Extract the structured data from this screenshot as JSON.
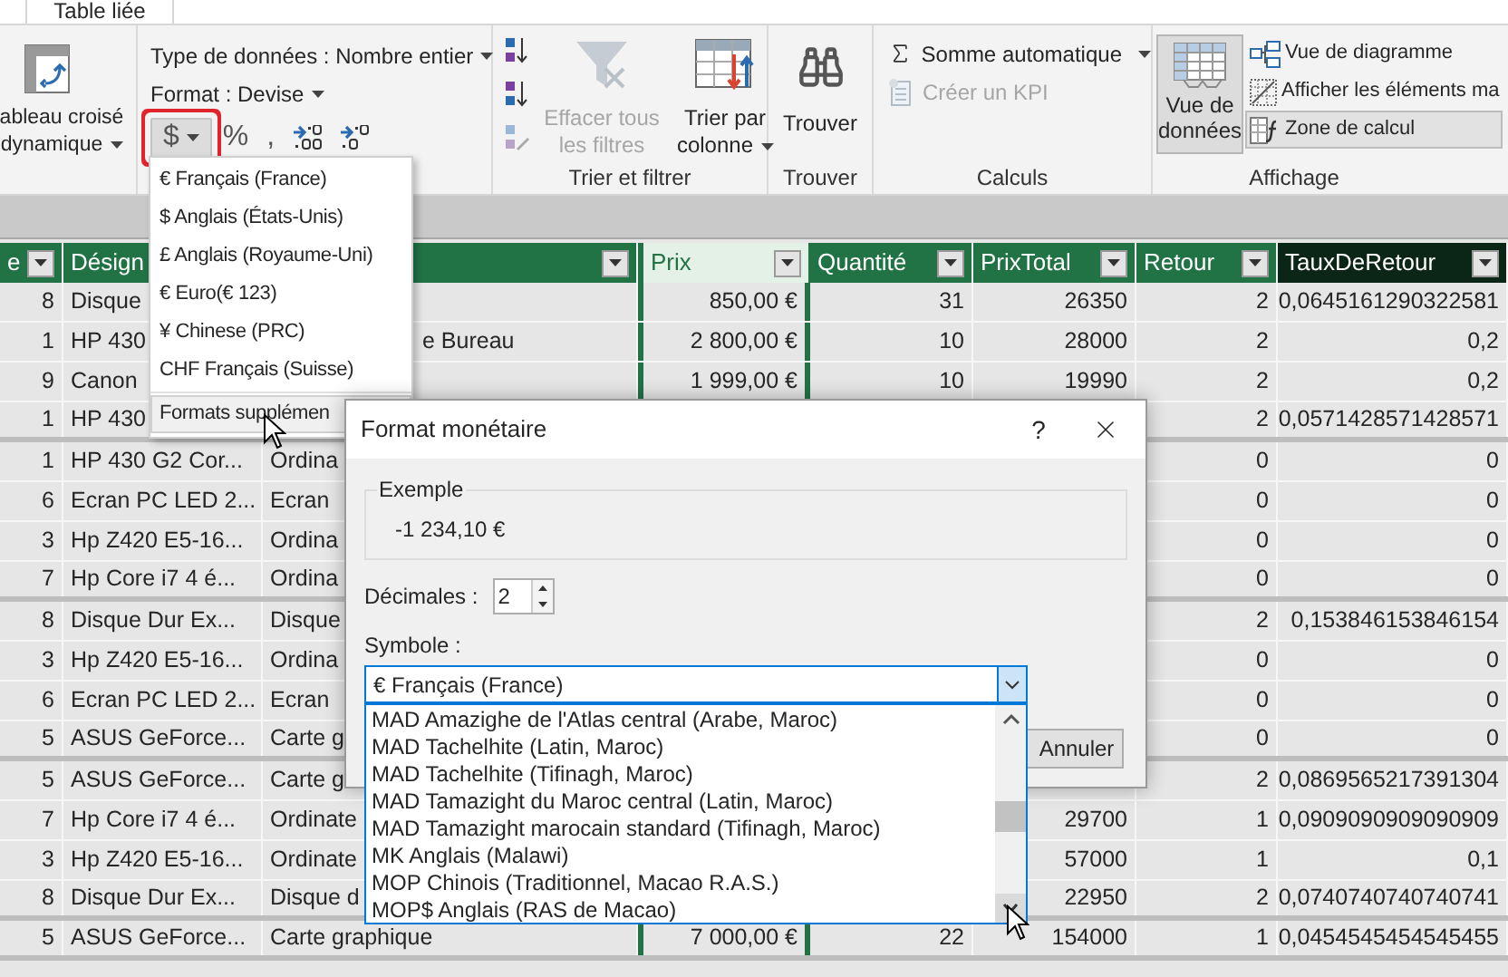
{
  "app_tab": {
    "label": "Table liée"
  },
  "ribbon": {
    "pivot": {
      "label": "ableau croisé dynamique"
    },
    "format_group": {
      "data_type": "Type de données : Nombre entier",
      "format": "Format : Devise",
      "buttons": [
        {
          "kind": "dropdown",
          "label": "$",
          "highlighted": true
        },
        {
          "kind": "text",
          "label": "%",
          "highlighted": false
        },
        {
          "kind": "text",
          "label": ",",
          "highlighted": false
        },
        {
          "kind": "increase-decimals",
          "highlighted": false
        },
        {
          "kind": "decrease-decimals",
          "highlighted": false
        }
      ]
    },
    "sort_group": {
      "title": "Trier et filtrer",
      "buttons": [
        {
          "kind": "clear-filters",
          "label": "Effacer tous les filtres",
          "disabled": true
        },
        {
          "kind": "sort-by-column",
          "label": "Trier par colonne",
          "disabled": false
        }
      ]
    },
    "find_group": {
      "button": "Trouver",
      "title": "Trouver"
    },
    "calc_group": {
      "title": "Calculs",
      "items": [
        {
          "kind": "autosum",
          "label": "Somme automatique",
          "disabled": false
        },
        {
          "kind": "kpi",
          "label": "Créer un KPI",
          "disabled": true
        }
      ]
    },
    "view_group": {
      "title": "Affichage",
      "data_view": {
        "label": "Vue de données",
        "selected": true
      },
      "items": [
        {
          "kind": "diagram",
          "label": "Vue de diagramme",
          "selected": false
        },
        {
          "kind": "hidden",
          "label": "Afficher les éléments ma",
          "selected": false
        },
        {
          "kind": "calc",
          "label": "Zone de calcul",
          "selected": true
        }
      ]
    }
  },
  "table": {
    "columns": [
      {
        "label": "e",
        "selected": false,
        "highlighted": false
      },
      {
        "label": "Désign",
        "selected": false,
        "highlighted": false
      },
      {
        "selected": false,
        "highlighted": false
      },
      {
        "label": "Prix",
        "selected": true,
        "highlighted": false
      },
      {
        "label": "Quantité",
        "selected": false,
        "highlighted": false
      },
      {
        "label": "PrixTotal",
        "selected": false,
        "highlighted": false
      },
      {
        "label": "Retour",
        "selected": false,
        "highlighted": false
      },
      {
        "label": "TauxDeRetour",
        "selected": false,
        "highlighted": true
      }
    ],
    "rows": [
      {
        "cells": [
          "8",
          "Disque",
          null,
          "850,00 €",
          "31",
          "26350",
          "2",
          "0,0645161290322581"
        ]
      },
      {
        "cells": [
          "1",
          "HP 430",
          {
            "kind": "cut",
            "text": "e Bureau"
          },
          "2 800,00 €",
          "10",
          "28000",
          "2",
          "0,2"
        ]
      },
      {
        "cells": [
          "9",
          "Canon",
          null,
          "1 999,00 €",
          "10",
          "19990",
          "2",
          "0,2"
        ]
      },
      {
        "cells": [
          "1",
          "HP 430",
          null,
          null,
          null,
          null,
          "2",
          "0,0571428571428571"
        ]
      },
      {
        "cells": [
          "1",
          "HP 430 G2 Cor...",
          "Ordina",
          null,
          null,
          null,
          "0",
          "0"
        ]
      },
      {
        "cells": [
          "6",
          "Ecran PC LED 2...",
          "Ecran",
          null,
          null,
          null,
          "0",
          "0"
        ]
      },
      {
        "cells": [
          "3",
          "Hp Z420 E5-16...",
          "Ordina",
          null,
          null,
          null,
          "0",
          "0"
        ]
      },
      {
        "cells": [
          "7",
          "Hp Core i7 4 é...",
          "Ordina",
          null,
          null,
          null,
          "0",
          "0"
        ]
      },
      {
        "cells": [
          "8",
          "Disque Dur Ex...",
          "Disque",
          null,
          null,
          null,
          "2",
          "0,153846153846154"
        ]
      },
      {
        "cells": [
          "3",
          "Hp Z420 E5-16...",
          "Ordina",
          null,
          null,
          null,
          "0",
          "0"
        ]
      },
      {
        "cells": [
          "6",
          "Ecran PC LED 2...",
          "Ecran",
          null,
          null,
          null,
          "0",
          "0"
        ]
      },
      {
        "cells": [
          "5",
          "ASUS GeForce...",
          "Carte g",
          null,
          null,
          null,
          "0",
          "0"
        ]
      },
      {
        "cells": [
          "5",
          "ASUS GeForce...",
          "Carte g",
          null,
          null,
          null,
          "2",
          "0,0869565217391304"
        ]
      },
      {
        "cells": [
          "7",
          "Hp Core i7 4 é...",
          "Ordinate",
          null,
          null,
          "29700",
          "1",
          "0,0909090909090909"
        ]
      },
      {
        "cells": [
          "3",
          "Hp Z420 E5-16...",
          "Ordinate",
          null,
          null,
          "57000",
          "1",
          "0,1"
        ]
      },
      {
        "cells": [
          "8",
          "Disque Dur Ex...",
          "Disque d",
          null,
          null,
          "22950",
          "2",
          "0,0740740740740741"
        ]
      },
      {
        "cells": [
          "5",
          "ASUS GeForce...",
          "Carte graphique",
          "7 000,00 €",
          "22",
          "154000",
          "1",
          "0,0454545454545455"
        ]
      }
    ]
  },
  "currency_menu": {
    "items": [
      {
        "label": "€ Français (France)",
        "selected": false
      },
      {
        "label": "$ Anglais (États-Unis)",
        "selected": false
      },
      {
        "label": "£ Anglais (Royaume-Uni)",
        "selected": false
      },
      {
        "label": "€ Euro(€ 123)",
        "selected": false
      },
      {
        "label": "¥ Chinese (PRC)",
        "selected": false
      },
      {
        "label": "CHF Français (Suisse)",
        "selected": false
      },
      {
        "label": "Formats supplémen",
        "selected": true
      }
    ]
  },
  "dialog": {
    "title": "Format monétaire",
    "help": "?",
    "example_label": "Exemple",
    "example_value": "-1 234,10 €",
    "decimals_label": "Décimales :",
    "decimals_value": "2",
    "symbol_label": "Symbole :",
    "symbol_value": "€ Français (France)",
    "symbol_options": [
      "MAD Amazighe de l'Atlas central (Arabe, Maroc)",
      "MAD Tachelhite (Latin, Maroc)",
      "MAD Tachelhite (Tifinagh, Maroc)",
      "MAD Tamazight du Maroc central (Latin, Maroc)",
      "MAD Tamazight marocain standard (Tifinagh, Maroc)",
      "MK Anglais (Malawi)",
      "MOP Chinois (Traditionnel, Macao R.A.S.)",
      "MOP$ Anglais (RAS de Macao)"
    ],
    "cancel": "Annuler"
  }
}
